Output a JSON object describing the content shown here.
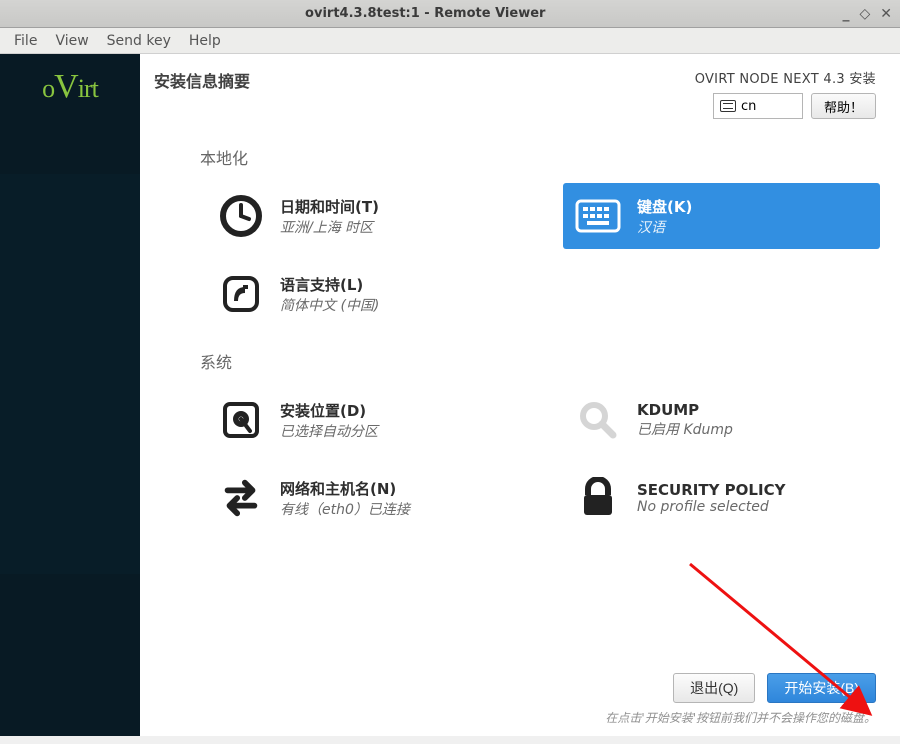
{
  "window": {
    "title": "ovirt4.3.8test:1 - Remote Viewer"
  },
  "menubar": {
    "file": "File",
    "view": "View",
    "sendkey": "Send key",
    "help": "Help"
  },
  "brand": "oVirt",
  "header": {
    "summary_title": "安装信息摘要",
    "product": "OVIRT NODE NEXT 4.3 安装",
    "lang_code": "cn",
    "help_btn": "帮助！"
  },
  "sections": {
    "localization": "本地化",
    "system": "系统"
  },
  "spokes": {
    "datetime": {
      "title": "日期和时间(T)",
      "sub": "亚洲/上海 时区"
    },
    "language": {
      "title": "语言支持(L)",
      "sub": "简体中文 (中国)"
    },
    "keyboard": {
      "title": "键盘(K)",
      "sub": "汉语"
    },
    "install_dest": {
      "title": "安装位置(D)",
      "sub": "已选择自动分区"
    },
    "network": {
      "title": "网络和主机名(N)",
      "sub": "有线（eth0）已连接"
    },
    "kdump": {
      "title": "KDUMP",
      "sub": "已启用 Kdump"
    },
    "security": {
      "title": "SECURITY POLICY",
      "sub": "No profile selected"
    }
  },
  "footer": {
    "quit": "退出(Q)",
    "begin": "开始安装(B)",
    "hint": "在点击'开始安装'按钮前我们并不会操作您的磁盘。"
  },
  "colors": {
    "accent": "#328fe1",
    "brand_green": "#89c53f"
  }
}
